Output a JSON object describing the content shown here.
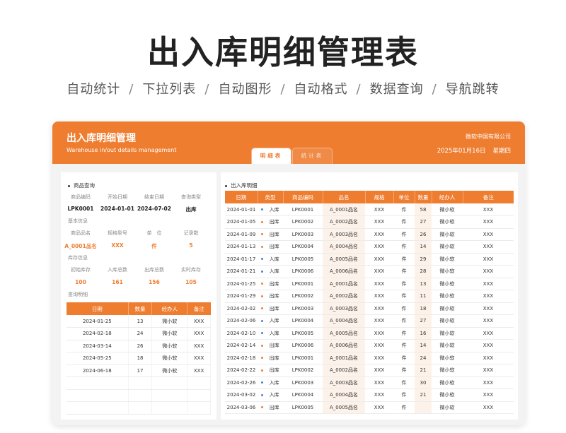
{
  "hero": {
    "title": "出入库明细管理表",
    "features": [
      "自动统计",
      "下拉列表",
      "自动图形",
      "自动格式",
      "数据查询",
      "导航跳转"
    ]
  },
  "header": {
    "title": "出入库明细管理",
    "subtitle": "Warehouse in/out details management",
    "company": "微软中国有限公司",
    "date": "2025年01月16日",
    "weekday": "星期四",
    "tabs": [
      {
        "label": "明细表",
        "active": true
      },
      {
        "label": "统计表",
        "active": false
      }
    ]
  },
  "left": {
    "query_title": "商品查询",
    "query_headers": [
      "商品编码",
      "开始日期",
      "结束日期",
      "查询类型"
    ],
    "query_values": [
      "LPK0001",
      "2024-01-01",
      "2024-07-02",
      "出库"
    ],
    "basic_label": "基本信息",
    "basic_headers": [
      "商品品名",
      "规格型号",
      "单　位",
      "记录数"
    ],
    "basic_values": [
      "A_0001品名",
      "XXX",
      "件",
      "5"
    ],
    "stock_label": "库存信息",
    "stock_headers": [
      "初始库存",
      "入库总数",
      "出库总数",
      "实时库存"
    ],
    "stock_values": [
      "100",
      "161",
      "156",
      "105"
    ],
    "detail_label": "查询明细",
    "detail_columns": [
      "日期",
      "数量",
      "经办人",
      "备注"
    ],
    "detail_rows": [
      [
        "2024-01-25",
        "13",
        "微小软",
        "XXX"
      ],
      [
        "2024-02-18",
        "24",
        "微小软",
        "XXX"
      ],
      [
        "2024-03-14",
        "26",
        "微小软",
        "XXX"
      ],
      [
        "2024-05-25",
        "18",
        "微小软",
        "XXX"
      ],
      [
        "2024-06-18",
        "17",
        "微小软",
        "XXX"
      ]
    ]
  },
  "right": {
    "title": "出入库明细",
    "columns": [
      "日期",
      "类型",
      "商品编码",
      "品名",
      "规格",
      "单位",
      "数量",
      "经办人",
      "备注"
    ],
    "rows": [
      [
        "2024-01-01",
        "入库",
        "LPK0001",
        "A_0001品名",
        "XXX",
        "件",
        "58",
        "微小软",
        "XXX"
      ],
      [
        "2024-01-05",
        "出库",
        "LPK0002",
        "A_0002品名",
        "XXX",
        "件",
        "27",
        "微小软",
        "XXX"
      ],
      [
        "2024-01-09",
        "出库",
        "LPK0003",
        "A_0003品名",
        "XXX",
        "件",
        "26",
        "微小软",
        "XXX"
      ],
      [
        "2024-01-13",
        "出库",
        "LPK0004",
        "A_0004品名",
        "XXX",
        "件",
        "14",
        "微小软",
        "XXX"
      ],
      [
        "2024-01-17",
        "入库",
        "LPK0005",
        "A_0005品名",
        "XXX",
        "件",
        "29",
        "微小软",
        "XXX"
      ],
      [
        "2024-01-21",
        "入库",
        "LPK0006",
        "A_0006品名",
        "XXX",
        "件",
        "28",
        "微小软",
        "XXX"
      ],
      [
        "2024-01-25",
        "出库",
        "LPK0001",
        "A_0001品名",
        "XXX",
        "件",
        "13",
        "微小软",
        "XXX"
      ],
      [
        "2024-01-29",
        "出库",
        "LPK0002",
        "A_0002品名",
        "XXX",
        "件",
        "11",
        "微小软",
        "XXX"
      ],
      [
        "2024-02-02",
        "出库",
        "LPK0003",
        "A_0003品名",
        "XXX",
        "件",
        "18",
        "微小软",
        "XXX"
      ],
      [
        "2024-02-06",
        "入库",
        "LPK0004",
        "A_0004品名",
        "XXX",
        "件",
        "27",
        "微小软",
        "XXX"
      ],
      [
        "2024-02-10",
        "入库",
        "LPK0005",
        "A_0005品名",
        "XXX",
        "件",
        "16",
        "微小软",
        "XXX"
      ],
      [
        "2024-02-14",
        "出库",
        "LPK0006",
        "A_0006品名",
        "XXX",
        "件",
        "14",
        "微小软",
        "XXX"
      ],
      [
        "2024-02-18",
        "出库",
        "LPK0001",
        "A_0001品名",
        "XXX",
        "件",
        "24",
        "微小软",
        "XXX"
      ],
      [
        "2024-02-22",
        "出库",
        "LPK0002",
        "A_0002品名",
        "XXX",
        "件",
        "21",
        "微小软",
        "XXX"
      ],
      [
        "2024-02-26",
        "入库",
        "LPK0003",
        "A_0003品名",
        "XXX",
        "件",
        "30",
        "微小软",
        "XXX"
      ],
      [
        "2024-03-02",
        "入库",
        "LPK0004",
        "A_0004品名",
        "XXX",
        "件",
        "21",
        "微小软",
        "XXX"
      ],
      [
        "2024-03-06",
        "出库",
        "LPK0005",
        "A_0005品名",
        "XXX",
        "件",
        "",
        "微小软",
        "XXX"
      ]
    ]
  }
}
